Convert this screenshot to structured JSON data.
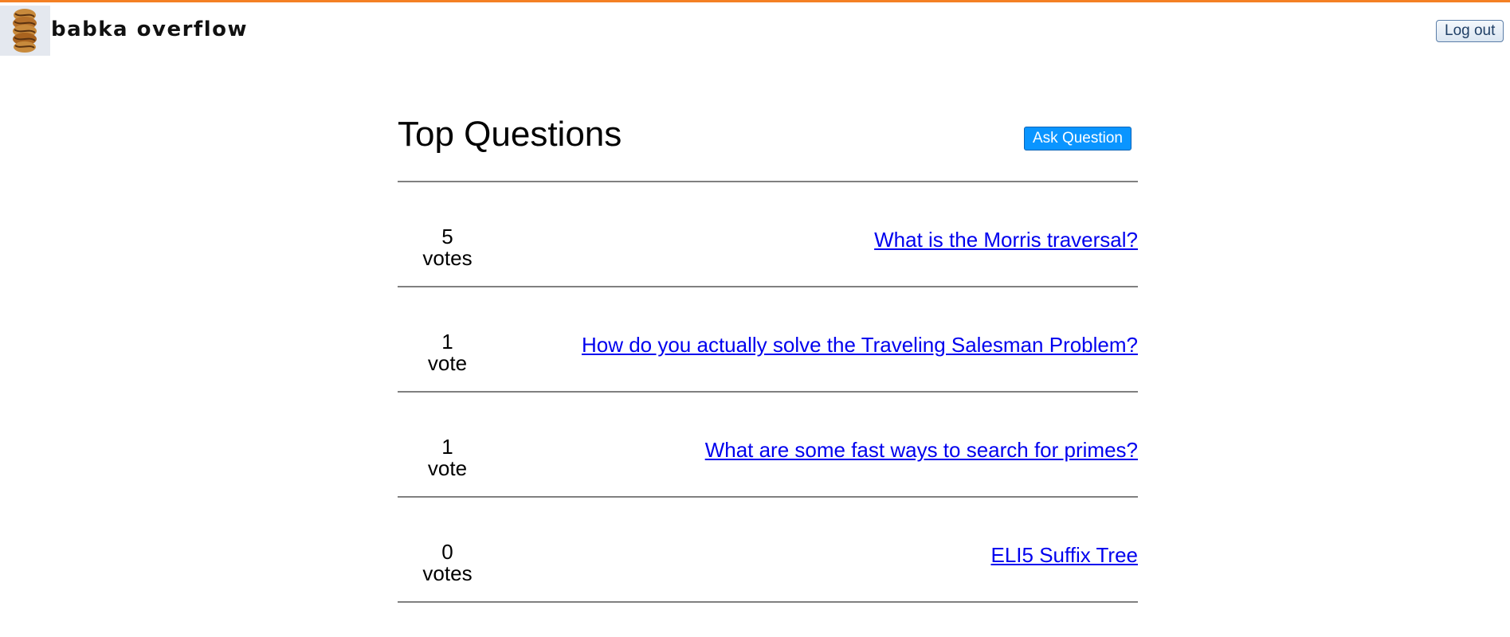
{
  "header": {
    "brand": "babka overflow",
    "logout_label": "Log out",
    "accent_color": "#f48024"
  },
  "main": {
    "title": "Top Questions",
    "ask_label": "Ask Question",
    "questions": [
      {
        "count": "5",
        "unit": "votes",
        "title": "What is the Morris traversal?"
      },
      {
        "count": "1",
        "unit": "vote",
        "title": "How do you actually solve the Traveling Salesman Problem?"
      },
      {
        "count": "1",
        "unit": "vote",
        "title": "What are some fast ways to search for primes?"
      },
      {
        "count": "0",
        "unit": "votes",
        "title": "ELI5 Suffix Tree"
      }
    ]
  }
}
